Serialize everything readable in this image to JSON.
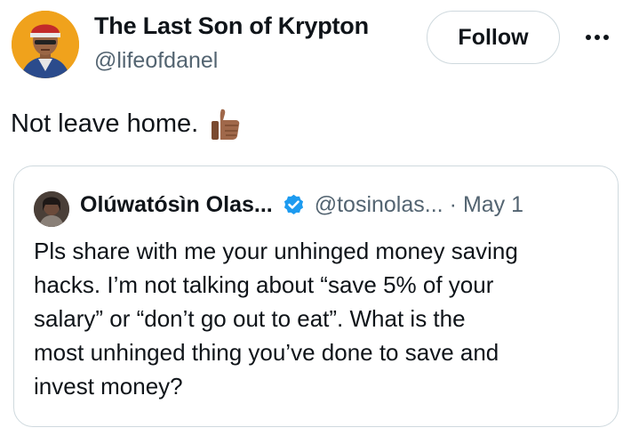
{
  "author": {
    "name": "The Last Son of Krypton",
    "handle": "@lifeofdanel",
    "avatar_icon": "cartoon-avatar-icon"
  },
  "actions": {
    "follow_label": "Follow",
    "more_icon": "more-horizontal-icon"
  },
  "tweet": {
    "text": "Not leave home.",
    "emoji": "thumbs-up-medium-dark-skin-tone"
  },
  "quoted": {
    "name": "Olúwatósìn Olas...",
    "verified_icon": "verified-badge-icon",
    "handle": "@tosinolas...",
    "separator": "·",
    "date": "May 1",
    "lines": [
      "Pls share with me your unhinged money saving",
      "hacks. I’m not talking about “save 5% of your",
      "salary” or “don’t go out to eat”. What is the",
      "most unhinged thing you’ve done to save and",
      "invest money?"
    ]
  },
  "colors": {
    "text": "#0f1419",
    "secondary": "#536471",
    "border": "#cfd9de",
    "verified": "#1d9bf0",
    "avatar_bg": "#f0a21c"
  }
}
